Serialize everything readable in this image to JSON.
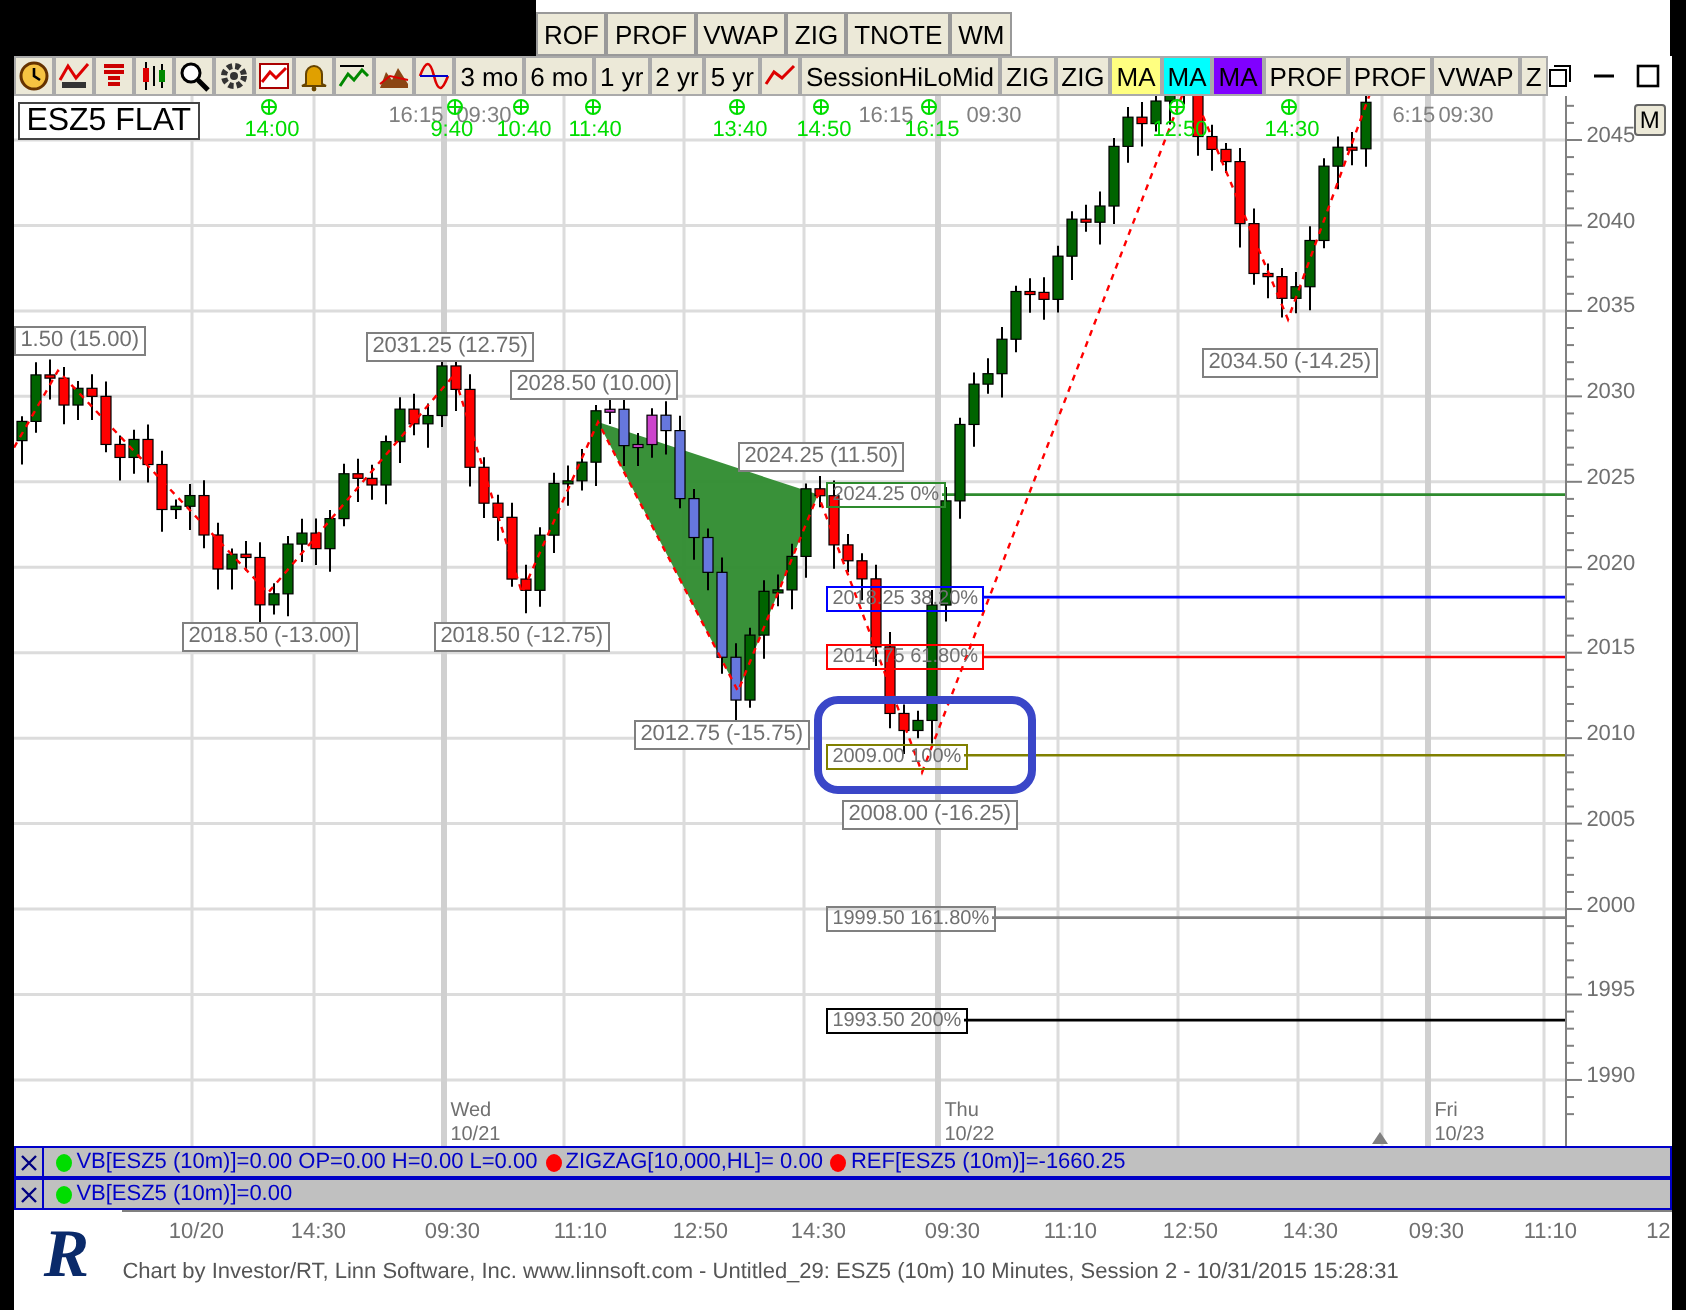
{
  "tabs": [
    "ROF",
    "PROF",
    "VWAP",
    "ZIG",
    "TNOTE",
    "WM"
  ],
  "toolbar": {
    "ranges": [
      "3 mo",
      "6 mo",
      "1 yr",
      "2 yr",
      "5 yr"
    ],
    "studies": [
      {
        "label": "SessionHiLoMid",
        "color": "#ece9d8"
      },
      {
        "label": "ZIG",
        "color": "#ece9d8"
      },
      {
        "label": "ZIG",
        "color": "#ece9d8"
      },
      {
        "label": "MA",
        "color": "#ffff80"
      },
      {
        "label": "MA",
        "color": "#00ffff"
      },
      {
        "label": "MA",
        "color": "#8000ff"
      },
      {
        "label": "PROF",
        "color": "#ece9d8"
      },
      {
        "label": "PROF",
        "color": "#ece9d8"
      },
      {
        "label": "VWAP",
        "color": "#ece9d8"
      },
      {
        "label": "Z",
        "color": "#ece9d8"
      }
    ]
  },
  "chart": {
    "symbol_label": "ESZ5 FLAT",
    "m_button": "M",
    "session_times": [
      "16:15",
      "09:30",
      "16:15",
      "09:30",
      "6:15",
      "09:30"
    ],
    "bar_markers": [
      "14:00",
      "9:40",
      "10:40",
      "11:40",
      "13:40",
      "14:50",
      "16:15",
      "12:50",
      "14:30"
    ],
    "swing_labels": [
      "1.50 (15.00)",
      "2031.25 (12.75)",
      "2028.50 (10.00)",
      "2024.25 (11.50)",
      "2018.50 (-13.00)",
      "2018.50 (-12.75)",
      "2012.75 (-15.75)",
      "2008.00 (-16.25)",
      "2034.50 (-14.25)"
    ],
    "fib_levels": [
      {
        "label": "2024.25 0%",
        "color": "#2e8b2e"
      },
      {
        "label": "2018.25 38.20%",
        "color": "#0000ff"
      },
      {
        "label": "2014.75 61.80%",
        "color": "#ff0000"
      },
      {
        "label": "2009.00 100%",
        "color": "#808000"
      },
      {
        "label": "1999.50 161.80%",
        "color": "#808080"
      },
      {
        "label": "1993.50 200%",
        "color": "#000000"
      }
    ],
    "price_ticks": [
      "2045",
      "2040",
      "2035",
      "2030",
      "2025",
      "2020",
      "2015",
      "2010",
      "2005",
      "2000",
      "1995",
      "1990"
    ],
    "day_labels": [
      {
        "day": "Wed",
        "date": "10/21"
      },
      {
        "day": "Thu",
        "date": "10/22"
      },
      {
        "day": "Fri",
        "date": "10/23"
      }
    ]
  },
  "indicator_panels": [
    {
      "items": [
        {
          "text": "VB[ESZ5 (10m)]=0.00 OP=0.00 H=0.00 L=0.00",
          "color": "#00dd00"
        },
        {
          "text": "ZIGZAG[10,000,HL]= 0.00",
          "color": "#ff0000"
        },
        {
          "text": "REF[ESZ5 (10m)]=-1660.25",
          "color": "#ff0000"
        }
      ]
    },
    {
      "items": [
        {
          "text": "VB[ESZ5 (10m)]=0.00",
          "color": "#00dd00"
        }
      ]
    }
  ],
  "time_axis": [
    "10/20",
    "14:30",
    "09:30",
    "11:10",
    "12:50",
    "14:30",
    "09:30",
    "11:10",
    "12:50",
    "14:30",
    "09:30",
    "11:10",
    "12"
  ],
  "footer": {
    "logo": "R",
    "text": "Chart by Investor/RT, Linn Software, Inc. www.linnsoft.com - Untitled_29: ESZ5 (10m) 10 Minutes, Session 2 - 10/31/2015 15:28:31"
  }
}
